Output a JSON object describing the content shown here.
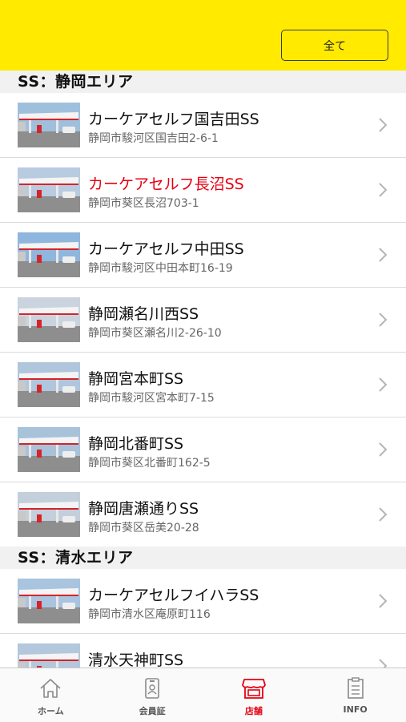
{
  "header": {
    "all_label": "全て"
  },
  "sections": [
    {
      "title": "SS：静岡エリア",
      "stations": [
        {
          "name": "カーケアセルフ国吉田SS",
          "address": "静岡市駿河区国吉田2-6-1",
          "active": false
        },
        {
          "name": "カーケアセルフ長沼SS",
          "address": "静岡市葵区長沼703-1",
          "active": true
        },
        {
          "name": "カーケアセルフ中田SS",
          "address": "静岡市駿河区中田本町16-19",
          "active": false
        },
        {
          "name": "静岡瀬名川西SS",
          "address": "静岡市葵区瀬名川2-26-10",
          "active": false
        },
        {
          "name": "静岡宮本町SS",
          "address": "静岡市駿河区宮本町7-15",
          "active": false
        },
        {
          "name": "静岡北番町SS",
          "address": "静岡市葵区北番町162-5",
          "active": false
        },
        {
          "name": "静岡唐瀬通りSS",
          "address": "静岡市葵区岳美20-28",
          "active": false
        }
      ]
    },
    {
      "title": "SS：清水エリア",
      "stations": [
        {
          "name": "カーケアセルフイハラSS",
          "address": "静岡市清水区庵原町116",
          "active": false
        },
        {
          "name": "清水天神町SS",
          "address": "",
          "active": false
        }
      ]
    }
  ],
  "tabs": [
    {
      "label": "ホーム",
      "icon": "home-icon",
      "active": false
    },
    {
      "label": "会員証",
      "icon": "member-card-icon",
      "active": false
    },
    {
      "label": "店舗",
      "icon": "store-icon",
      "active": true
    },
    {
      "label": "INFO",
      "icon": "info-document-icon",
      "active": false
    }
  ],
  "colors": {
    "header": "#ffea00",
    "accent": "#e60012"
  }
}
